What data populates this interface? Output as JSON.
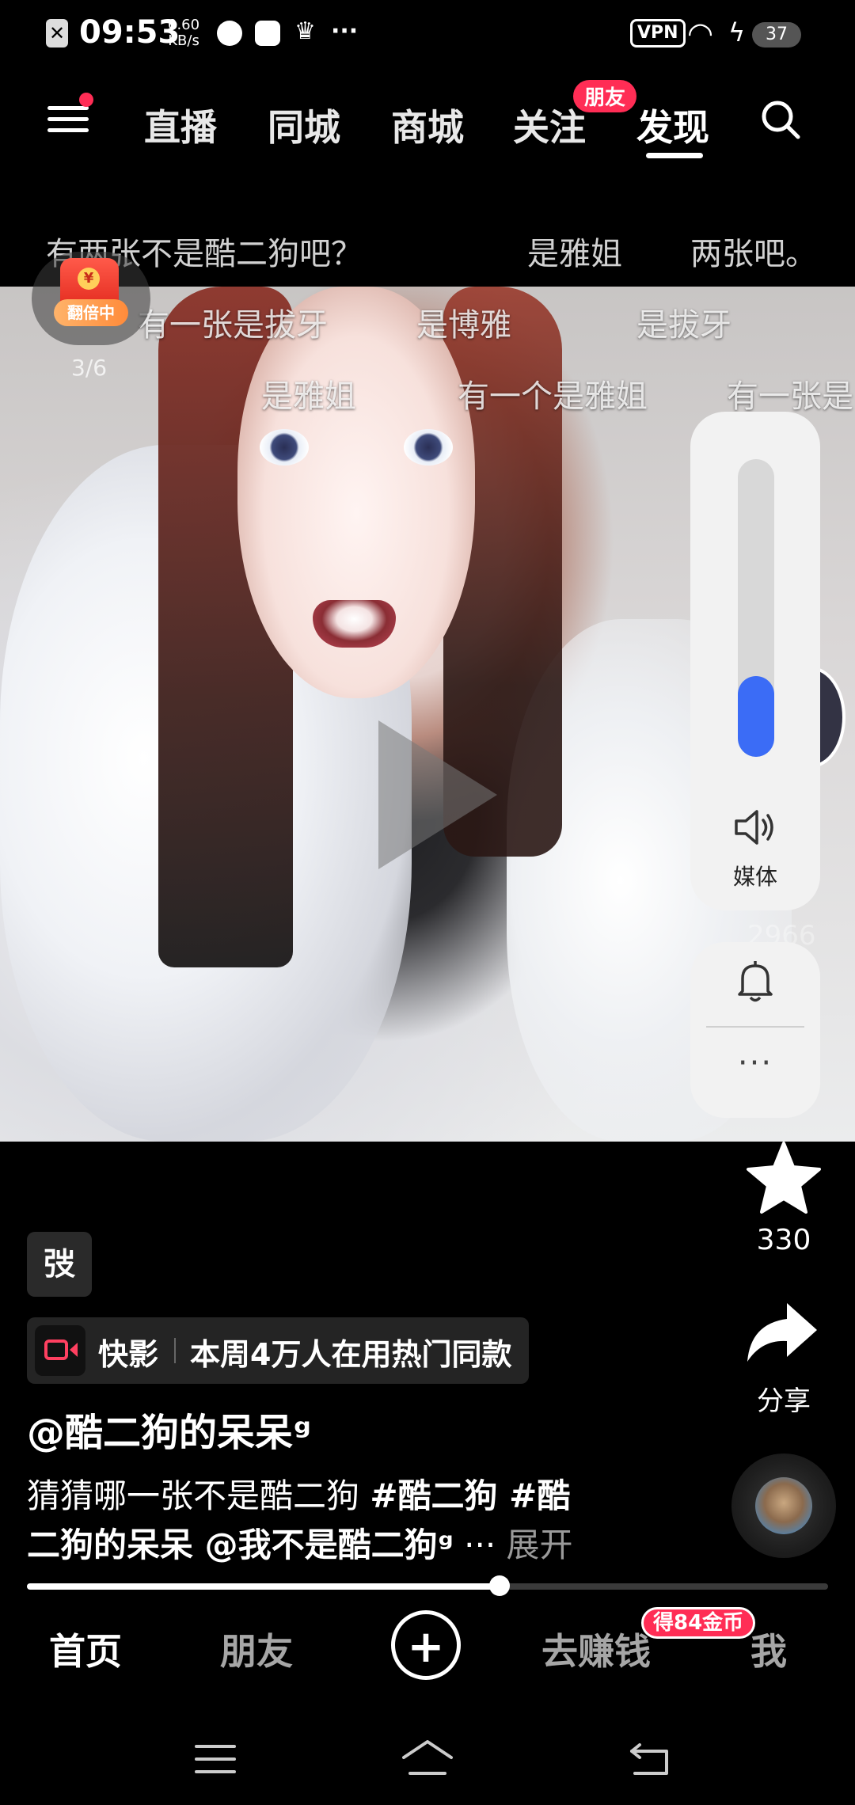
{
  "status_bar": {
    "time": "09:53",
    "speed_value": "0.60",
    "speed_unit": "KB/s",
    "vpn_label": "VPN",
    "battery": "37",
    "more": "···",
    "icons": [
      "screenshot-off-icon",
      "speedometer-icon",
      "media-icon",
      "crown-icon",
      "wifi-icon",
      "charging-icon"
    ]
  },
  "top_nav": {
    "tabs": [
      "直播",
      "同城",
      "商城",
      "关注",
      "发现"
    ],
    "active_tab": "发现",
    "friend_badge": "朋友"
  },
  "danmaku": [
    "有两张不是酷二狗吧？",
    "是雅姐",
    "两张吧。",
    "有一张是拔牙",
    "是博雅",
    "是拔牙",
    "是雅姐",
    "有一个是雅姐",
    "有一张是"
  ],
  "red_packet": {
    "label": "翻倍中",
    "count": "3/6"
  },
  "volume_panel": {
    "level_percent": 27,
    "label": "媒体",
    "more": "···"
  },
  "peek_count": "2966",
  "actions": {
    "favorite_count": "330",
    "share_label": "分享"
  },
  "caption": {
    "tag_chip": "弢",
    "kuaiying_name": "快影",
    "kuaiying_desc": "本周4万人在用热门同款",
    "author": "@酷二狗的呆呆ᵍ",
    "desc_line1_text": "猜猜哪一张不是酷二狗 ",
    "desc_tag1": "#酷二狗",
    "desc_tag2_part1": " #酷",
    "desc_tag2_part2": "二狗的呆呆",
    "desc_mention": " @我不是酷二狗ᵍ",
    "desc_ellipsis": " ··· ",
    "expand": "展开"
  },
  "progress": {
    "percent": 59
  },
  "bottom_tabs": {
    "home": "首页",
    "friends": "朋友",
    "plus": "+",
    "earn": "去赚钱",
    "coin_badge": "得84金币",
    "me": "我"
  },
  "colors": {
    "accent_red": "#ff2d55",
    "volume_blue": "#3b6cf6"
  }
}
